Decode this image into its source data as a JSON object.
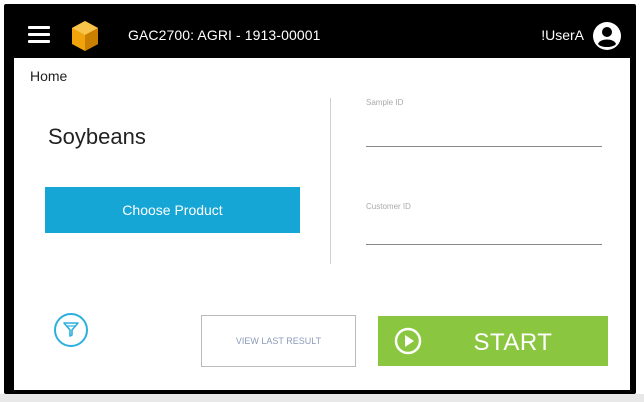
{
  "header": {
    "title": "GAC2700: AGRI - 1913-00001",
    "user": "!UserA"
  },
  "breadcrumb": "Home",
  "product": {
    "name": "Soybeans",
    "choose_label": "Choose Product"
  },
  "fields": {
    "sample_id": {
      "label": "Sample ID",
      "value": ""
    },
    "customer_id": {
      "label": "Customer ID",
      "value": ""
    }
  },
  "actions": {
    "view_last_label": "VIEW LAST RESULT",
    "start_label": "START"
  },
  "colors": {
    "topbar": "#000000",
    "choose_button": "#15a6d6",
    "start_button": "#8ac640",
    "filter_icon": "#2bb0df",
    "logo": "#f0a30a"
  },
  "icons": {
    "menu": "menu-icon",
    "logo": "logo-icon",
    "user": "user-icon",
    "filter": "filter-icon",
    "play": "play-icon"
  }
}
